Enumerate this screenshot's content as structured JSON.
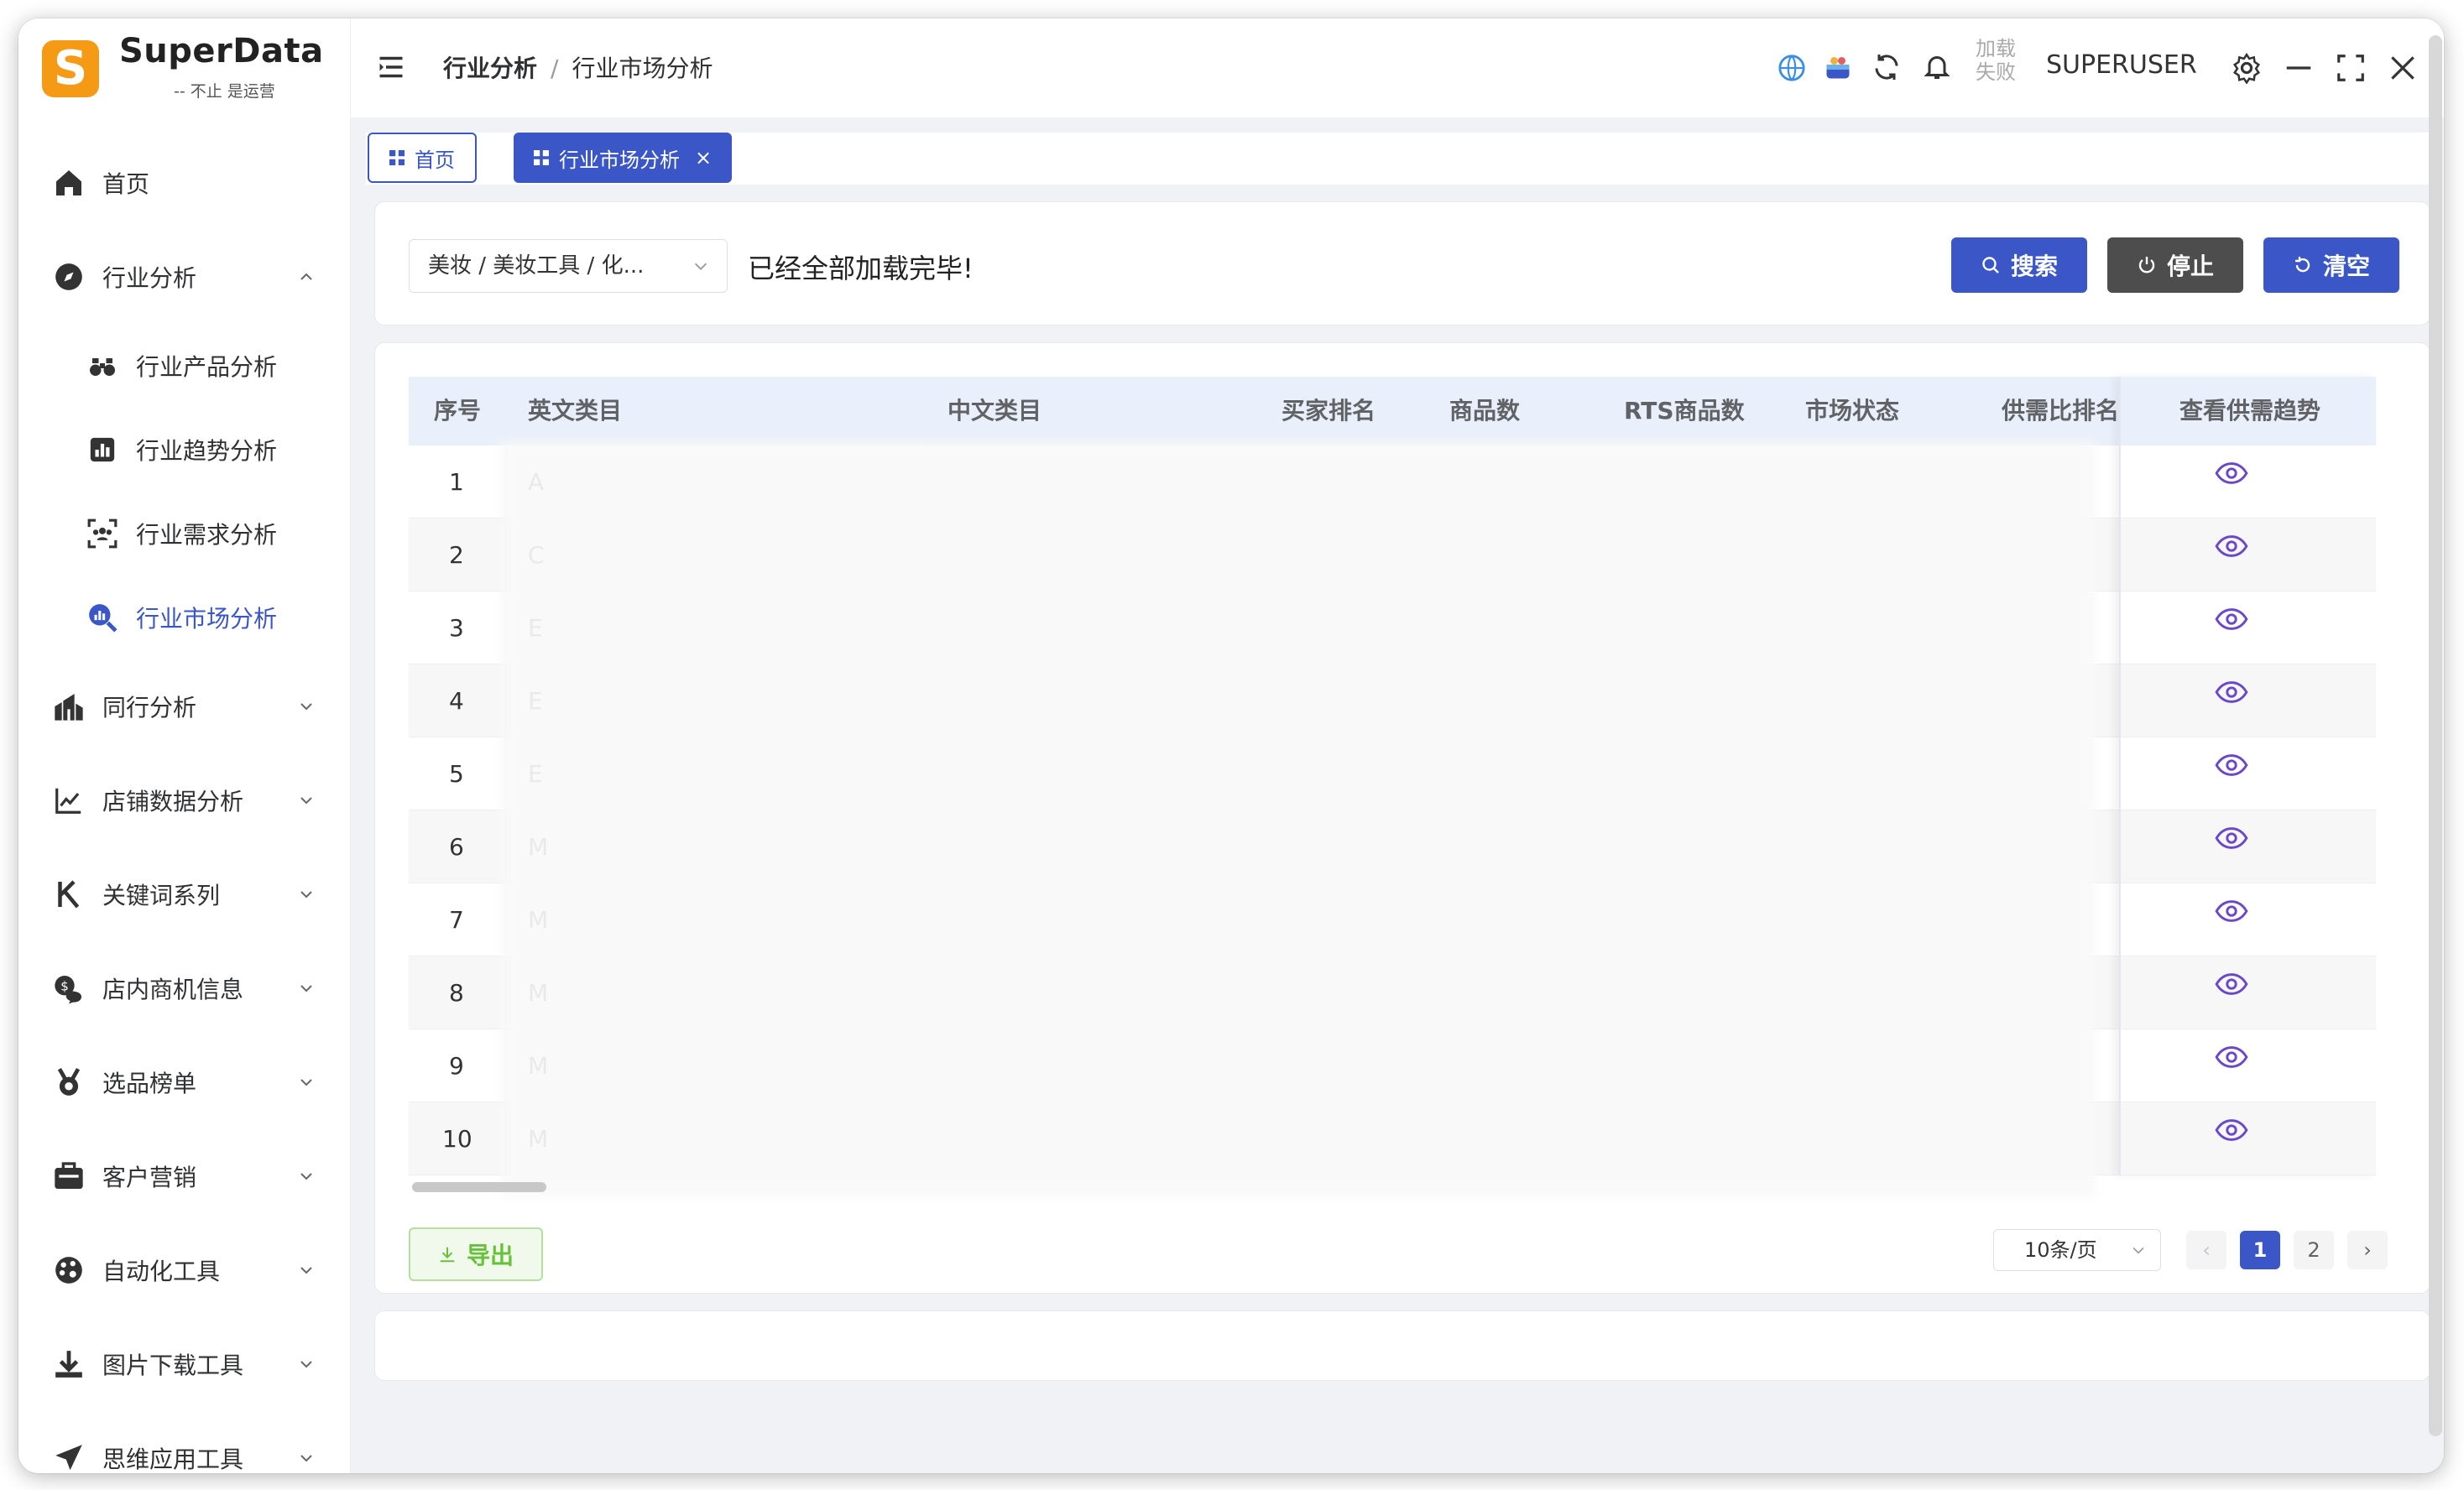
{
  "app": {
    "brand": "SuperData",
    "slogan": "-- 不止 是运营",
    "logo_letter": "S"
  },
  "header": {
    "breadcrumb": [
      "行业分析",
      "行业市场分析"
    ],
    "load_failed": "加载失败",
    "username": "SUPERUSER"
  },
  "sidebar": {
    "items": [
      {
        "label": "首页",
        "icon": "home-icon"
      },
      {
        "label": "行业分析",
        "icon": "compass-icon",
        "expanded": true
      },
      {
        "label": "行业产品分析",
        "icon": "binoculars-icon"
      },
      {
        "label": "行业趋势分析",
        "icon": "bar-chart-icon"
      },
      {
        "label": "行业需求分析",
        "icon": "people-scan-icon"
      },
      {
        "label": "行业市场分析",
        "icon": "search-chart-icon",
        "active": true
      },
      {
        "label": "同行分析",
        "icon": "building-icon"
      },
      {
        "label": "店铺数据分析",
        "icon": "line-chart-icon"
      },
      {
        "label": "关键词系列",
        "icon": "k-icon"
      },
      {
        "label": "店内商机信息",
        "icon": "chat-coin-icon"
      },
      {
        "label": "选品榜单",
        "icon": "medal-icon"
      },
      {
        "label": "客户营销",
        "icon": "briefcase-icon"
      },
      {
        "label": "自动化工具",
        "icon": "palette-icon"
      },
      {
        "label": "图片下载工具",
        "icon": "download-icon"
      },
      {
        "label": "思维应用工具",
        "icon": "send-icon"
      }
    ]
  },
  "tabs": {
    "home": "首页",
    "current": "行业市场分析",
    "close": "×"
  },
  "search": {
    "category_value": "美妆 / 美妆工具 / 化...",
    "status": "已经全部加载完毕!",
    "search_label": "搜索",
    "stop_label": "停止",
    "clear_label": "清空"
  },
  "table": {
    "headers": [
      "序号",
      "英文类目",
      "中文类目",
      "买家排名",
      "商品数",
      "RTS商品数",
      "市场状态",
      "供需比排名",
      "查看供需趋势"
    ],
    "rows": [
      {
        "index": "1",
        "en": "A"
      },
      {
        "index": "2",
        "en": "C"
      },
      {
        "index": "3",
        "en": "E"
      },
      {
        "index": "4",
        "en": "E"
      },
      {
        "index": "5",
        "en": "E"
      },
      {
        "index": "6",
        "en": "M"
      },
      {
        "index": "7",
        "en": "M"
      },
      {
        "index": "8",
        "en": "M"
      },
      {
        "index": "9",
        "en": "M"
      },
      {
        "index": "10",
        "en": "M"
      }
    ]
  },
  "footer": {
    "export_label": "导出",
    "page_size": "10条/页",
    "prev": "‹",
    "next": "›",
    "pages": [
      "1",
      "2"
    ],
    "current_page": "1"
  },
  "colors": {
    "primary": "#3a56c7",
    "logo": "#f59a14",
    "stop": "#4d4d4d",
    "export": "#67c23a",
    "eye": "#6a48c8"
  }
}
